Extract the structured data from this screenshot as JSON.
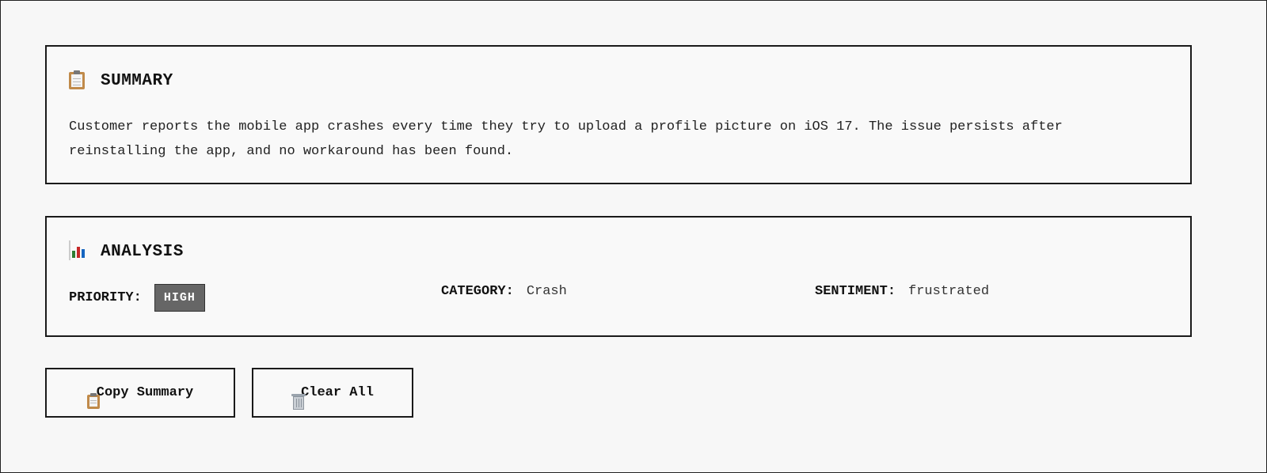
{
  "summary": {
    "icon": "clipboard-icon",
    "title": "SUMMARY",
    "text": "Customer reports the mobile app crashes every time they try to upload a profile picture on iOS 17. The issue persists after reinstalling the app, and no workaround has been found."
  },
  "analysis": {
    "icon": "bar-chart-icon",
    "title": "ANALYSIS",
    "priority_label": "PRIORITY:",
    "priority_value": "HIGH",
    "category_label": "CATEGORY:",
    "category_value": "Crash",
    "sentiment_label": "SENTIMENT:",
    "sentiment_value": "frustrated"
  },
  "actions": {
    "copy_label": "Copy Summary",
    "copy_icon": "clipboard-icon",
    "clear_label": "Clear All",
    "clear_icon": "trash-icon"
  },
  "colors": {
    "background": "#f7f7f7",
    "border": "#1a1a1a",
    "badge_bg": "#666666",
    "badge_text": "#ffffff"
  }
}
